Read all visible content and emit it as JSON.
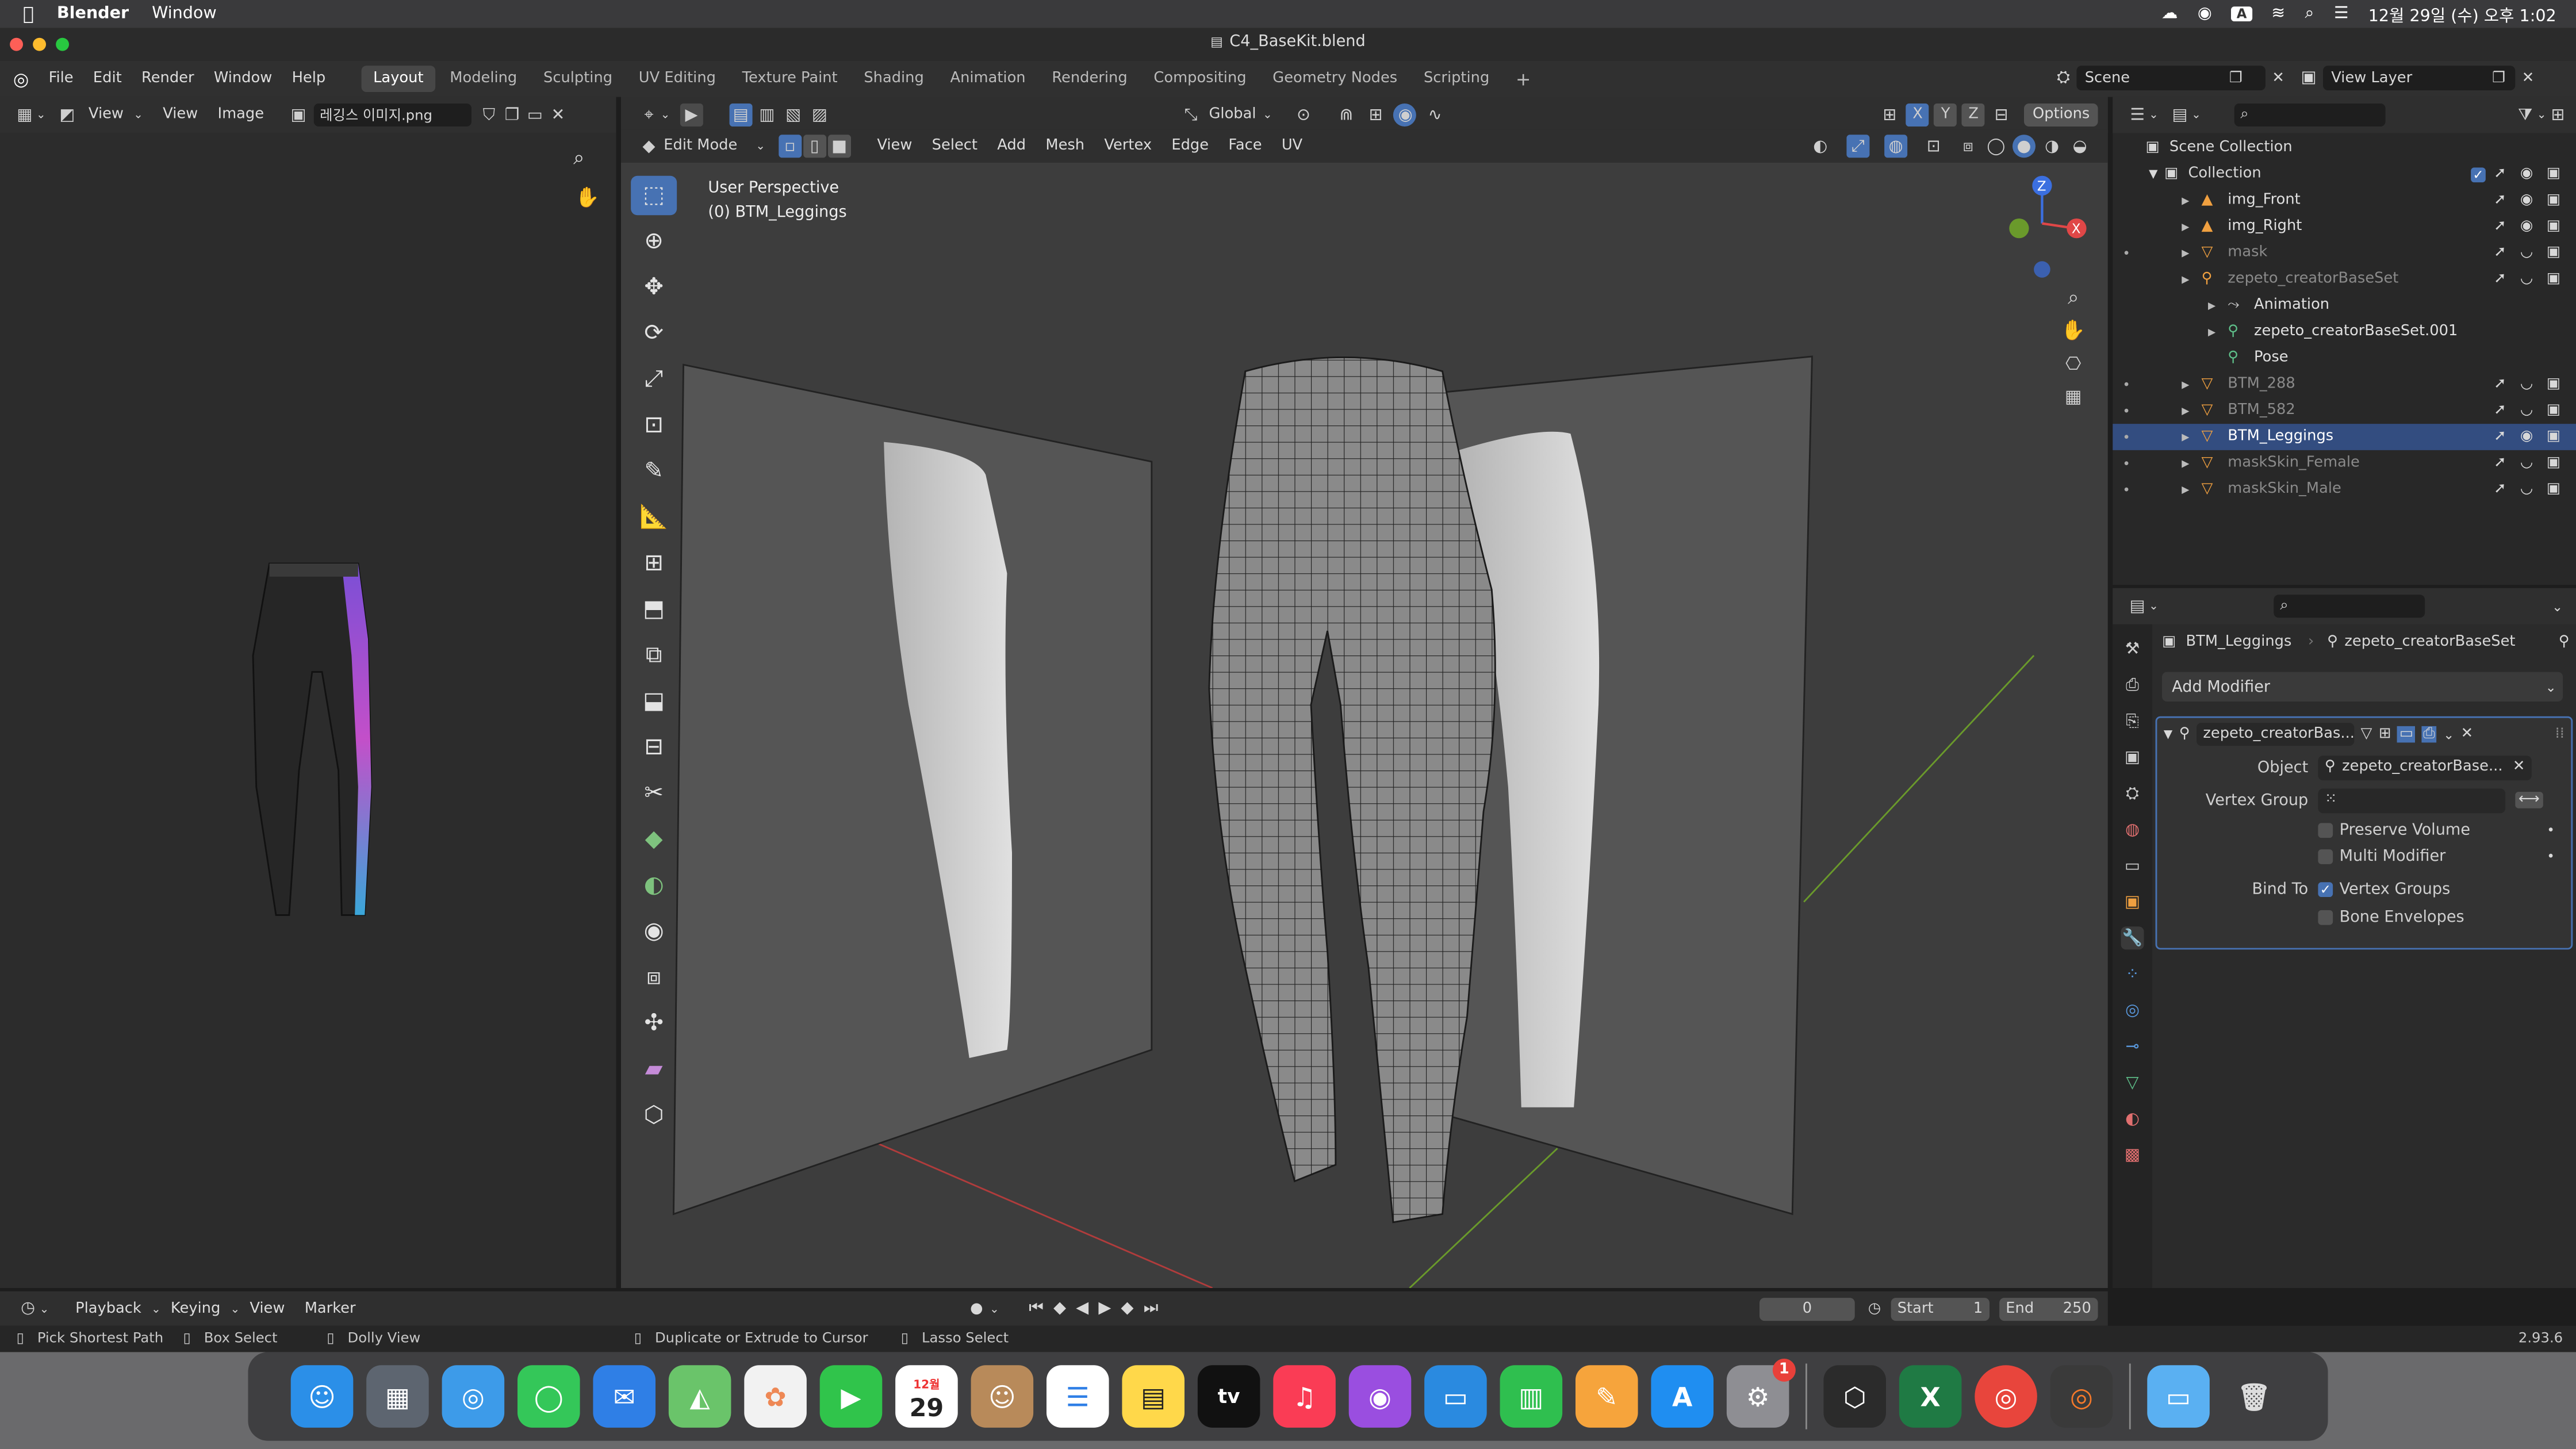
{
  "macos_menubar": {
    "app_name": "Blender",
    "menu_window": "Window",
    "clock": "12월 29일 (수) 오후 1:02",
    "input_indicator": "A"
  },
  "window": {
    "title": "C4_BaseKit.blend"
  },
  "top_menu": [
    "File",
    "Edit",
    "Render",
    "Window",
    "Help"
  ],
  "workspace_tabs": [
    "Layout",
    "Modeling",
    "Sculpting",
    "UV Editing",
    "Texture Paint",
    "Shading",
    "Animation",
    "Rendering",
    "Compositing",
    "Geometry Nodes",
    "Scripting"
  ],
  "active_workspace": "Layout",
  "scene_selector": {
    "label": "Scene",
    "view_layer": "View Layer"
  },
  "image_editor": {
    "menus": [
      "View",
      "View",
      "Image"
    ],
    "image_name": "레깅스 이미지.png"
  },
  "viewport": {
    "mode": "Edit Mode",
    "menus": [
      "View",
      "Select",
      "Add",
      "Mesh",
      "Vertex",
      "Edge",
      "Face",
      "UV"
    ],
    "transform_orientation": "Global",
    "axes": [
      "X",
      "Y",
      "Z"
    ],
    "options_label": "Options",
    "overlay_title": "User Perspective",
    "overlay_object": "(0) BTM_Leggings",
    "gizmo_labels": [
      "Z",
      "X"
    ]
  },
  "outliner": {
    "root": "Scene Collection",
    "collection": "Collection",
    "items": [
      {
        "label": "img_Front",
        "color": "#e0e0e0"
      },
      {
        "label": "img_Right",
        "color": "#e0e0e0"
      },
      {
        "label": "mask",
        "color": "#8a8a8a"
      },
      {
        "label": "zepeto_creatorBaseSet",
        "color": "#8a8a8a"
      },
      {
        "label": "Animation",
        "color": "#e0e0e0"
      },
      {
        "label": "zepeto_creatorBaseSet.001",
        "color": "#e0e0e0"
      },
      {
        "label": "Pose",
        "color": "#e0e0e0"
      },
      {
        "label": "BTM_288",
        "color": "#8a8a8a"
      },
      {
        "label": "BTM_582",
        "color": "#8a8a8a"
      },
      {
        "label": "BTM_Leggings",
        "color": "#ffffff"
      },
      {
        "label": "maskSkin_Female",
        "color": "#8a8a8a"
      },
      {
        "label": "maskSkin_Male",
        "color": "#8a8a8a"
      }
    ]
  },
  "properties": {
    "object_name": "BTM_Leggings",
    "armature_name": "zepeto_creatorBaseSet",
    "add_modifier": "Add Modifier",
    "modifier_name": "zepeto_creatorBas...",
    "object_label": "Object",
    "object_value": "zepeto_creatorBase...",
    "vertex_group_label": "Vertex Group",
    "preserve_volume": "Preserve Volume",
    "multi_modifier": "Multi Modifier",
    "bind_to_label": "Bind To",
    "vertex_groups": "Vertex Groups",
    "bone_envelopes": "Bone Envelopes"
  },
  "timeline": {
    "menus": [
      "Playback",
      "Keying",
      "View",
      "Marker"
    ],
    "current_frame": "0",
    "start_label": "Start",
    "start_value": "1",
    "end_label": "End",
    "end_value": "250"
  },
  "statusbar": {
    "items": [
      "Pick Shortest Path",
      "Box Select",
      "Dolly View",
      "Duplicate or Extrude to Cursor",
      "Lasso Select"
    ],
    "version": "2.93.6"
  },
  "dock": {
    "calendar_month": "12월",
    "calendar_day": "29",
    "settings_badge": "1"
  }
}
